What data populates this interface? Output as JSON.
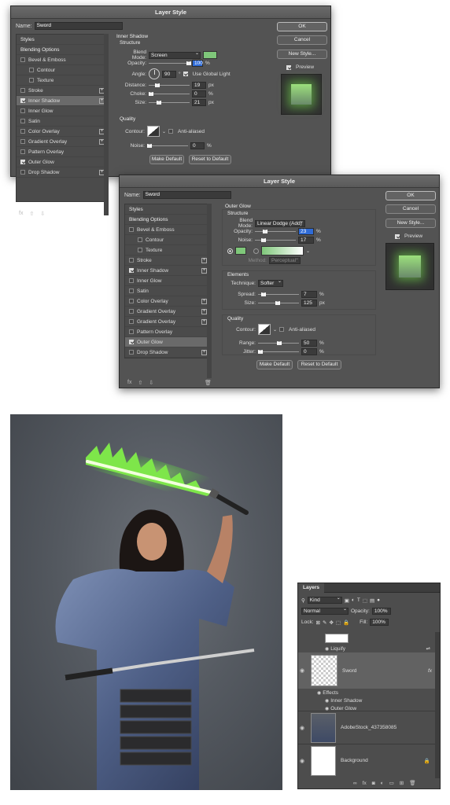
{
  "dialog1": {
    "title": "Layer Style",
    "name_label": "Name:",
    "name_value": "Sword",
    "styles": [
      {
        "label": "Styles",
        "type": "header"
      },
      {
        "label": "Blending Options",
        "type": "header"
      },
      {
        "label": "Bevel & Emboss",
        "checked": false
      },
      {
        "label": "Contour",
        "checked": false,
        "indent": true
      },
      {
        "label": "Texture",
        "checked": false,
        "indent": true
      },
      {
        "label": "Stroke",
        "checked": false,
        "plus": true
      },
      {
        "label": "Inner Shadow",
        "checked": true,
        "plus": true,
        "selected": true
      },
      {
        "label": "Inner Glow",
        "checked": false
      },
      {
        "label": "Satin",
        "checked": false
      },
      {
        "label": "Color Overlay",
        "checked": false,
        "plus": true
      },
      {
        "label": "Gradient Overlay",
        "checked": false,
        "plus": true
      },
      {
        "label": "Pattern Overlay",
        "checked": false
      },
      {
        "label": "Outer Glow",
        "checked": true
      },
      {
        "label": "Drop Shadow",
        "checked": false,
        "plus": true
      }
    ],
    "section_title": "Inner Shadow",
    "structure": "Structure",
    "blend_mode_label": "Blend Mode:",
    "blend_mode": "Screen",
    "swatch_color": "#7fc77a",
    "opacity_label": "Opacity:",
    "opacity": "100",
    "pct": "%",
    "angle_label": "Angle:",
    "angle": "90",
    "deg": "°",
    "global_light": "Use Global Light",
    "distance_label": "Distance:",
    "distance": "19",
    "px": "px",
    "choke_label": "Choke:",
    "choke": "0",
    "size_label": "Size:",
    "size": "21",
    "quality": "Quality",
    "contour_label": "Contour:",
    "anti_aliased": "Anti-aliased",
    "noise_label": "Noise:",
    "noise": "0",
    "make_default": "Make Default",
    "reset_default": "Reset to Default",
    "ok": "OK",
    "cancel": "Cancel",
    "new_style": "New Style...",
    "preview": "Preview",
    "fx": "fx"
  },
  "dialog2": {
    "title": "Layer Style",
    "name_label": "Name:",
    "name_value": "Sword",
    "styles": [
      {
        "label": "Styles",
        "type": "header"
      },
      {
        "label": "Blending Options",
        "type": "header"
      },
      {
        "label": "Bevel & Emboss",
        "checked": false
      },
      {
        "label": "Contour",
        "checked": false,
        "indent": true
      },
      {
        "label": "Texture",
        "checked": false,
        "indent": true
      },
      {
        "label": "Stroke",
        "checked": false,
        "plus": true
      },
      {
        "label": "Inner Shadow",
        "checked": true,
        "plus": true
      },
      {
        "label": "Inner Glow",
        "checked": false
      },
      {
        "label": "Satin",
        "checked": false
      },
      {
        "label": "Color Overlay",
        "checked": false,
        "plus": true
      },
      {
        "label": "Gradient Overlay",
        "checked": false,
        "plus": true
      },
      {
        "label": "Gradient Overlay",
        "checked": false,
        "plus": true
      },
      {
        "label": "Pattern Overlay",
        "checked": false
      },
      {
        "label": "Outer Glow",
        "checked": true,
        "selected": true
      },
      {
        "label": "Drop Shadow",
        "checked": false,
        "plus": true
      }
    ],
    "section_title": "Outer Glow",
    "structure": "Structure",
    "blend_mode_label": "Blend Mode:",
    "blend_mode": "Linear Dodge (Add)",
    "opacity_label": "Opacity:",
    "opacity": "23",
    "pct": "%",
    "noise_label": "Noise:",
    "noise": "17",
    "swatch_color": "#7fc77a",
    "method_label": "Method:",
    "method": "Perceptual",
    "elements": "Elements",
    "technique_label": "Technique:",
    "technique": "Softer",
    "spread_label": "Spread:",
    "spread": "7",
    "size_label": "Size:",
    "size": "125",
    "px": "px",
    "quality": "Quality",
    "contour_label": "Contour:",
    "anti_aliased": "Anti-aliased",
    "range_label": "Range:",
    "range": "50",
    "jitter_label": "Jitter:",
    "jitter": "0",
    "make_default": "Make Default",
    "reset_default": "Reset to Default",
    "ok": "OK",
    "cancel": "Cancel",
    "new_style": "New Style...",
    "preview": "Preview",
    "fx": "fx"
  },
  "layers": {
    "tab": "Layers",
    "kind": "Kind",
    "blend": "Normal",
    "opacity_label": "Opacity:",
    "opacity": "100%",
    "lock_label": "Lock:",
    "fill_label": "Fill:",
    "fill": "100%",
    "liquify": "Liquify",
    "sword": "Sword",
    "fx": "fx",
    "effects": "Effects",
    "inner_shadow": "Inner Shadow",
    "outer_glow": "Outer Glow",
    "adobe": "AdobeStock_437358085",
    "background": "Background"
  }
}
